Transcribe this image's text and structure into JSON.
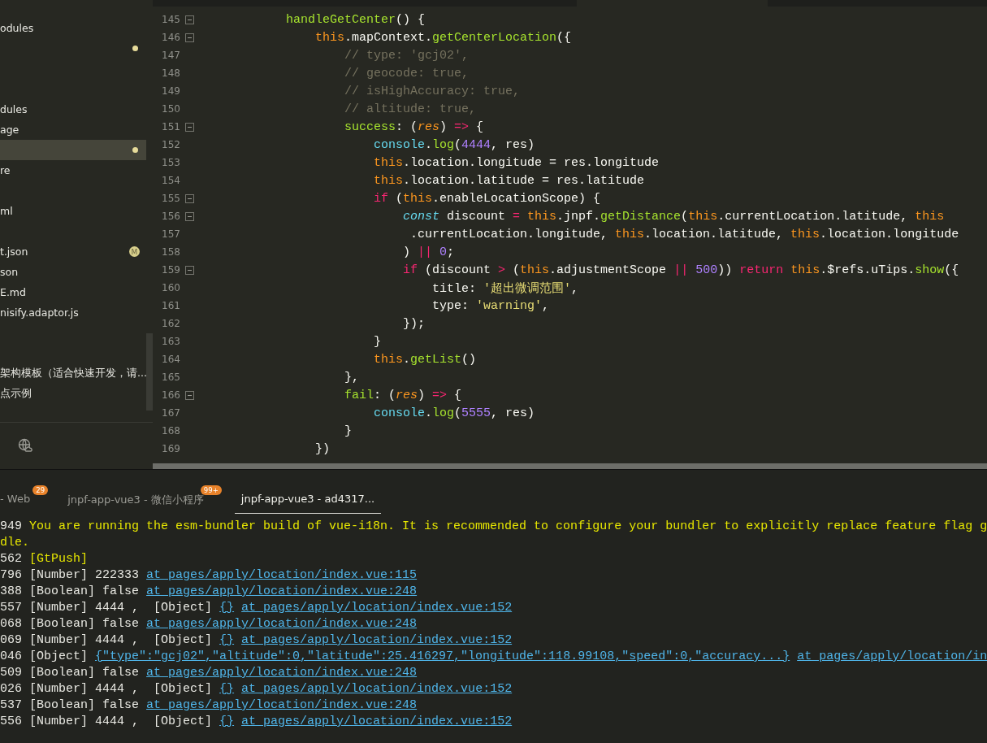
{
  "sidebar": {
    "items": [
      {
        "kind": "file",
        "label": "odules",
        "modified": false,
        "selected": false
      },
      {
        "kind": "file",
        "modified": true,
        "selected": false
      },
      {
        "kind": "blank"
      },
      {
        "kind": "blank"
      },
      {
        "kind": "file",
        "label": "dules",
        "modified": false,
        "selected": false
      },
      {
        "kind": "file",
        "label": "age",
        "modified": false,
        "selected": false
      },
      {
        "kind": "file",
        "modified": true,
        "selected": true
      },
      {
        "kind": "file",
        "label": "re",
        "modified": false,
        "selected": false
      },
      {
        "kind": "blank"
      },
      {
        "kind": "file",
        "label": "ml",
        "modified": false,
        "selected": false
      },
      {
        "kind": "blank"
      },
      {
        "kind": "file",
        "label": "t.json",
        "modified": false,
        "badge": "M",
        "selected": false
      },
      {
        "kind": "file",
        "label": "son",
        "modified": false,
        "selected": false
      },
      {
        "kind": "file",
        "label": "E.md",
        "modified": false,
        "selected": false
      },
      {
        "kind": "file",
        "label": "nisify.adaptor.js",
        "modified": false,
        "selected": false
      },
      {
        "kind": "blank"
      },
      {
        "kind": "blank"
      },
      {
        "kind": "file",
        "label": "架构模板（适合快速开发，请...",
        "modified": false,
        "selected": false
      },
      {
        "kind": "file",
        "label": "点示例",
        "modified": false,
        "selected": false
      }
    ]
  },
  "editor": {
    "lines": [
      {
        "number": "145",
        "foldable": true,
        "tokens": [
          {
            "kind": "fn",
            "text": "handleGetCenter"
          },
          {
            "kind": "plain",
            "text": "() {"
          }
        ],
        "children": [
          {
            "number": "146",
            "foldable": true,
            "tokens": [
              {
                "kind": "this",
                "text": "this"
              },
              {
                "kind": "plain",
                "text": ".mapContext."
              },
              {
                "kind": "fn",
                "text": "getCenterLocation"
              },
              {
                "kind": "plain",
                "text": "({"
              }
            ],
            "children": [
              {
                "number": "147",
                "foldable": false,
                "tokens": [
                  {
                    "kind": "comment",
                    "text": "// type: 'gcj02',"
                  }
                ]
              },
              {
                "number": "148",
                "foldable": false,
                "tokens": [
                  {
                    "kind": "comment",
                    "text": "// geocode: true,"
                  }
                ]
              },
              {
                "number": "149",
                "foldable": false,
                "tokens": [
                  {
                    "kind": "comment",
                    "text": "// isHighAccuracy: true,"
                  }
                ]
              },
              {
                "number": "150",
                "foldable": false,
                "tokens": [
                  {
                    "kind": "comment",
                    "text": "// altitude: true,"
                  }
                ]
              },
              {
                "number": "151",
                "foldable": true,
                "tokens": [
                  {
                    "kind": "fn",
                    "text": "success"
                  },
                  {
                    "kind": "plain",
                    "text": ": ("
                  },
                  {
                    "kind": "param",
                    "text": "res"
                  },
                  {
                    "kind": "plain",
                    "text": ") "
                  },
                  {
                    "kind": "op",
                    "text": "=>"
                  },
                  {
                    "kind": "plain",
                    "text": " {"
                  }
                ],
                "children": [
                  {
                    "number": "152",
                    "foldable": false,
                    "tokens": [
                      {
                        "kind": "builtin",
                        "text": "console"
                      },
                      {
                        "kind": "plain",
                        "text": "."
                      },
                      {
                        "kind": "fn",
                        "text": "log"
                      },
                      {
                        "kind": "plain",
                        "text": "("
                      },
                      {
                        "kind": "num",
                        "text": "4444"
                      },
                      {
                        "kind": "plain",
                        "text": ", res)"
                      }
                    ]
                  },
                  {
                    "number": "153",
                    "foldable": false,
                    "tokens": [
                      {
                        "kind": "this",
                        "text": "this"
                      },
                      {
                        "kind": "plain",
                        "text": ".location.longitude = res.longitude"
                      }
                    ]
                  },
                  {
                    "number": "154",
                    "foldable": false,
                    "tokens": [
                      {
                        "kind": "this",
                        "text": "this"
                      },
                      {
                        "kind": "plain",
                        "text": ".location.latitude = res.latitude"
                      }
                    ]
                  },
                  {
                    "number": "155",
                    "foldable": true,
                    "tokens": [
                      {
                        "kind": "op",
                        "text": "if"
                      },
                      {
                        "kind": "plain",
                        "text": " ("
                      },
                      {
                        "kind": "this",
                        "text": "this"
                      },
                      {
                        "kind": "plain",
                        "text": ".enableLocationScope) {"
                      }
                    ],
                    "children": [
                      {
                        "number": "156",
                        "foldable": true,
                        "tokens": [
                          {
                            "kind": "storage",
                            "text": "const"
                          },
                          {
                            "kind": "plain",
                            "text": " discount "
                          },
                          {
                            "kind": "op",
                            "text": "= "
                          },
                          {
                            "kind": "this",
                            "text": "this"
                          },
                          {
                            "kind": "plain",
                            "text": ".jnpf."
                          },
                          {
                            "kind": "fn",
                            "text": "getDistance"
                          },
                          {
                            "kind": "plain",
                            "text": "("
                          },
                          {
                            "kind": "this",
                            "text": "this"
                          },
                          {
                            "kind": "plain",
                            "text": ".currentLocation.latitude, "
                          },
                          {
                            "kind": "this",
                            "text": "this"
                          }
                        ]
                      },
                      {
                        "number": "157",
                        "foldable": false,
                        "tokens": [
                          {
                            "kind": "plain",
                            "text": " .currentLocation.longitude, "
                          },
                          {
                            "kind": "this",
                            "text": "this"
                          },
                          {
                            "kind": "plain",
                            "text": ".location.latitude, "
                          },
                          {
                            "kind": "this",
                            "text": "this"
                          },
                          {
                            "kind": "plain",
                            "text": ".location.longitude"
                          }
                        ]
                      },
                      {
                        "number": "158",
                        "foldable": false,
                        "tokens": [
                          {
                            "kind": "plain",
                            "text": ") "
                          },
                          {
                            "kind": "op",
                            "text": "|| "
                          },
                          {
                            "kind": "num",
                            "text": "0"
                          },
                          {
                            "kind": "plain",
                            "text": ";"
                          }
                        ]
                      },
                      {
                        "number": "159",
                        "foldable": true,
                        "tokens": [
                          {
                            "kind": "op",
                            "text": "if"
                          },
                          {
                            "kind": "plain",
                            "text": " (discount "
                          },
                          {
                            "kind": "op",
                            "text": ">"
                          },
                          {
                            "kind": "plain",
                            "text": " ("
                          },
                          {
                            "kind": "this",
                            "text": "this"
                          },
                          {
                            "kind": "plain",
                            "text": ".adjustmentScope "
                          },
                          {
                            "kind": "op",
                            "text": "|| "
                          },
                          {
                            "kind": "num",
                            "text": "500"
                          },
                          {
                            "kind": "plain",
                            "text": ")) "
                          },
                          {
                            "kind": "op",
                            "text": "return "
                          },
                          {
                            "kind": "this",
                            "text": "this"
                          },
                          {
                            "kind": "plain",
                            "text": ".$refs.uTips."
                          },
                          {
                            "kind": "fn",
                            "text": "show"
                          },
                          {
                            "kind": "plain",
                            "text": "({"
                          }
                        ],
                        "children": [
                          {
                            "number": "160",
                            "foldable": false,
                            "tokens": [
                              {
                                "kind": "plain",
                                "text": "title: "
                              },
                              {
                                "kind": "str",
                                "text": "'超出微调范围'"
                              },
                              {
                                "kind": "plain",
                                "text": ","
                              }
                            ]
                          },
                          {
                            "number": "161",
                            "foldable": false,
                            "tokens": [
                              {
                                "kind": "plain",
                                "text": "type: "
                              },
                              {
                                "kind": "str",
                                "text": "'warning'"
                              },
                              {
                                "kind": "plain",
                                "text": ","
                              }
                            ]
                          }
                        ]
                      },
                      {
                        "number": "162",
                        "foldable": false,
                        "tokens": [
                          {
                            "kind": "plain",
                            "text": "});"
                          }
                        ]
                      }
                    ]
                  },
                  {
                    "number": "163",
                    "foldable": false,
                    "tokens": [
                      {
                        "kind": "plain",
                        "text": "}"
                      }
                    ]
                  },
                  {
                    "number": "164",
                    "foldable": false,
                    "tokens": [
                      {
                        "kind": "this",
                        "text": "this"
                      },
                      {
                        "kind": "plain",
                        "text": "."
                      },
                      {
                        "kind": "fn",
                        "text": "getList"
                      },
                      {
                        "kind": "plain",
                        "text": "()"
                      }
                    ]
                  }
                ]
              },
              {
                "number": "165",
                "foldable": false,
                "tokens": [
                  {
                    "kind": "plain",
                    "text": "},"
                  }
                ]
              },
              {
                "number": "166",
                "foldable": true,
                "tokens": [
                  {
                    "kind": "fn",
                    "text": "fail"
                  },
                  {
                    "kind": "plain",
                    "text": ": ("
                  },
                  {
                    "kind": "param",
                    "text": "res"
                  },
                  {
                    "kind": "plain",
                    "text": ") "
                  },
                  {
                    "kind": "op",
                    "text": "=>"
                  },
                  {
                    "kind": "plain",
                    "text": " {"
                  }
                ],
                "children": [
                  {
                    "number": "167",
                    "foldable": false,
                    "tokens": [
                      {
                        "kind": "builtin",
                        "text": "console"
                      },
                      {
                        "kind": "plain",
                        "text": "."
                      },
                      {
                        "kind": "fn",
                        "text": "log"
                      },
                      {
                        "kind": "plain",
                        "text": "("
                      },
                      {
                        "kind": "num",
                        "text": "5555"
                      },
                      {
                        "kind": "plain",
                        "text": ", res)"
                      }
                    ]
                  }
                ]
              },
              {
                "number": "168",
                "foldable": false,
                "tokens": [
                  {
                    "kind": "plain",
                    "text": "}"
                  }
                ]
              }
            ]
          },
          {
            "number": "169",
            "foldable": false,
            "tokens": [
              {
                "kind": "plain",
                "text": "})"
              }
            ]
          }
        ]
      }
    ]
  },
  "console": {
    "tabs": [
      {
        "label": "- Web",
        "badge": "29",
        "selected": false
      },
      {
        "label": "jnpf-app-vue3 - 微信小程序",
        "badge": "99+",
        "selected": false
      },
      {
        "label": "jnpf-app-vue3 - ad4317...",
        "selected": true
      }
    ],
    "lines": [
      {
        "prefix": "949",
        "parts": [
          {
            "kind": "warn",
            "text": "You are running the esm-bundler build of vue-i18n. It is recommended to configure your bundler to explicitly replace feature flag g"
          }
        ]
      },
      {
        "parts": [
          {
            "kind": "warn",
            "text": "dle."
          }
        ]
      },
      {
        "prefix": "562",
        "parts": [
          {
            "kind": "warn",
            "text": "[GtPush]"
          }
        ]
      },
      {
        "prefix": "796",
        "parts": [
          {
            "kind": "plain",
            "text": "[Number] 222333"
          },
          {
            "kind": "link",
            "text": "at pages/apply/location/index.vue:115"
          }
        ]
      },
      {
        "prefix": "388",
        "parts": [
          {
            "kind": "plain",
            "text": "[Boolean] false"
          },
          {
            "kind": "link",
            "text": "at pages/apply/location/index.vue:248"
          }
        ]
      },
      {
        "prefix": "557",
        "parts": [
          {
            "kind": "plain",
            "text": "[Number] 4444 ,  [Object]"
          },
          {
            "kind": "link",
            "text": "{}"
          },
          {
            "kind": "link",
            "text": "at pages/apply/location/index.vue:152"
          }
        ]
      },
      {
        "prefix": "068",
        "parts": [
          {
            "kind": "plain",
            "text": "[Boolean] false"
          },
          {
            "kind": "link",
            "text": "at pages/apply/location/index.vue:248"
          }
        ]
      },
      {
        "prefix": "069",
        "parts": [
          {
            "kind": "plain",
            "text": "[Number] 4444 ,  [Object]"
          },
          {
            "kind": "link",
            "text": "{}"
          },
          {
            "kind": "link",
            "text": "at pages/apply/location/index.vue:152"
          }
        ]
      },
      {
        "prefix": "046",
        "parts": [
          {
            "kind": "plain",
            "text": "[Object]"
          },
          {
            "kind": "link",
            "text": "{\"type\":\"gcj02\",\"altitude\":0,\"latitude\":25.416297,\"longitude\":118.99108,\"speed\":0,\"accuracy...}"
          },
          {
            "kind": "link",
            "text": "at pages/apply/location/in"
          }
        ]
      },
      {
        "prefix": "509",
        "parts": [
          {
            "kind": "plain",
            "text": "[Boolean] false"
          },
          {
            "kind": "link",
            "text": "at pages/apply/location/index.vue:248"
          }
        ]
      },
      {
        "prefix": "026",
        "parts": [
          {
            "kind": "plain",
            "text": "[Number] 4444 ,  [Object]"
          },
          {
            "kind": "link",
            "text": "{}"
          },
          {
            "kind": "link",
            "text": "at pages/apply/location/index.vue:152"
          }
        ]
      },
      {
        "prefix": "537",
        "parts": [
          {
            "kind": "plain",
            "text": "[Boolean] false"
          },
          {
            "kind": "link",
            "text": "at pages/apply/location/index.vue:248"
          }
        ]
      },
      {
        "prefix": "556",
        "parts": [
          {
            "kind": "plain",
            "text": "[Number] 4444 ,  [Object]"
          },
          {
            "kind": "link",
            "text": "{}"
          },
          {
            "kind": "link",
            "text": "at pages/apply/location/index.vue:152"
          }
        ]
      }
    ]
  }
}
